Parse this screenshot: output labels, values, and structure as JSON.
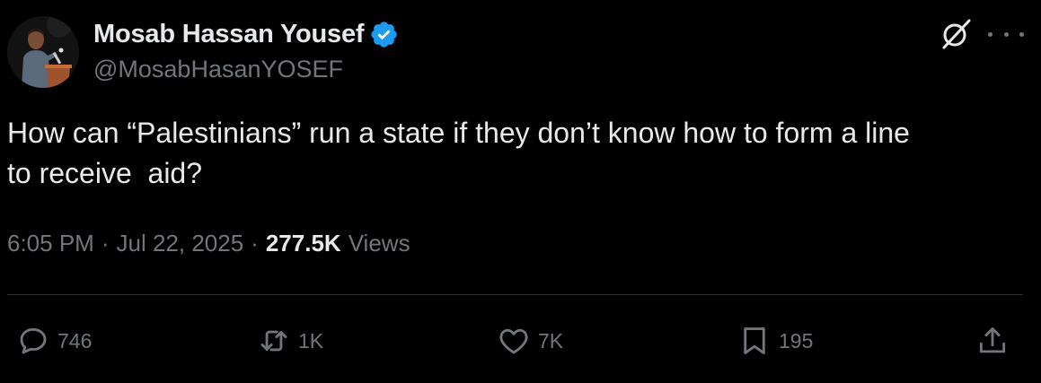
{
  "author": {
    "display_name": "Mosab Hassan Yousef",
    "handle": "@MosabHasanYOSEF",
    "verified": true,
    "verified_color": "#1d9bf0"
  },
  "tweet": {
    "text": "How can “Palestinians” run a state if they don’t know how to form a line\nto receive  aid?",
    "time": "6:05 PM",
    "date": "Jul 22, 2025",
    "separator": "·",
    "views_count": "277.5K",
    "views_label": "Views"
  },
  "actions": {
    "replies": "746",
    "reposts": "1K",
    "likes": "7K",
    "bookmarks": "195"
  },
  "icons": {
    "header": [
      "grok-icon",
      "more-icon"
    ],
    "actions": [
      "reply-icon",
      "repost-icon",
      "like-icon",
      "bookmark-icon",
      "share-icon"
    ]
  },
  "colors": {
    "background": "#000000",
    "primary_text": "#e7e9ea",
    "secondary_text": "#71767b",
    "divider": "#2f3336"
  }
}
